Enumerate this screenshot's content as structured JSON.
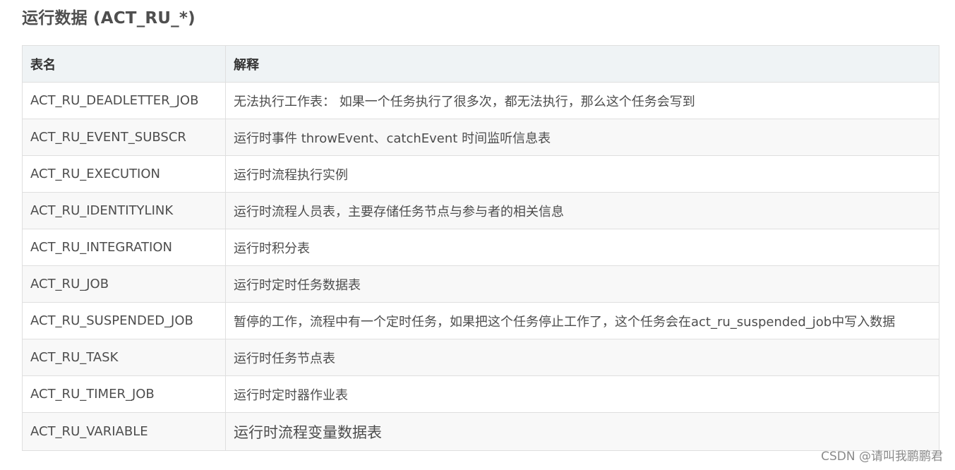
{
  "title": "运行数据 (ACT_RU_*)",
  "table": {
    "headers": [
      "表名",
      "解释"
    ],
    "rows": [
      {
        "name": "ACT_RU_DEADLETTER_JOB",
        "desc": "无法执行工作表： 如果一个任务执行了很多次，都无法执行，那么这个任务会写到"
      },
      {
        "name": "ACT_RU_EVENT_SUBSCR",
        "desc": "运行时事件 throwEvent、catchEvent 时间监听信息表"
      },
      {
        "name": "ACT_RU_EXECUTION",
        "desc": "运行时流程执行实例"
      },
      {
        "name": "ACT_RU_IDENTITYLINK",
        "desc": "运行时流程人员表，主要存储任务节点与参与者的相关信息"
      },
      {
        "name": "ACT_RU_INTEGRATION",
        "desc": "运行时积分表"
      },
      {
        "name": "ACT_RU_JOB",
        "desc": "运行时定时任务数据表"
      },
      {
        "name": "ACT_RU_SUSPENDED_JOB",
        "desc": "暂停的工作，流程中有一个定时任务，如果把这个任务停止工作了，这个任务会在act_ru_suspended_job中写入数据"
      },
      {
        "name": "ACT_RU_TASK",
        "desc": "运行时任务节点表"
      },
      {
        "name": "ACT_RU_TIMER_JOB",
        "desc": "运行时定时器作业表"
      },
      {
        "name": "ACT_RU_VARIABLE",
        "desc": "运行时流程变量数据表"
      }
    ]
  },
  "watermark": "CSDN @请叫我鹏鹏君"
}
